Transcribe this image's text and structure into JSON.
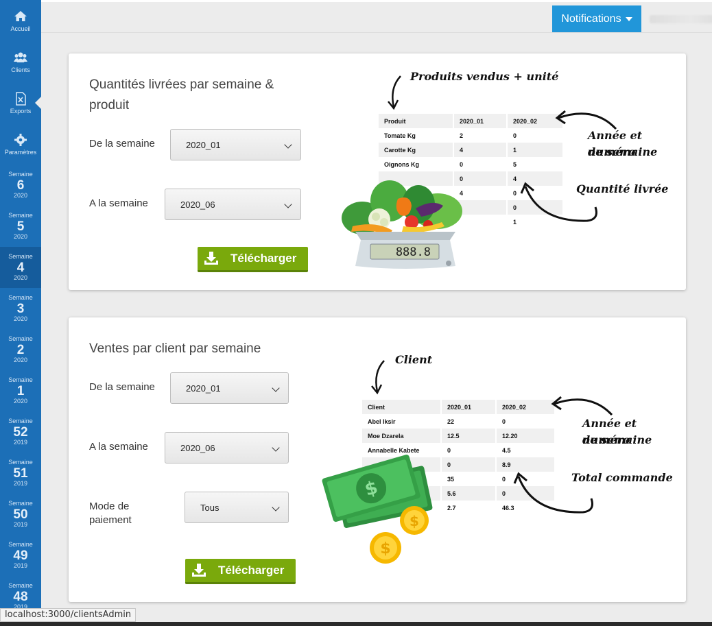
{
  "sidebar": {
    "items": [
      {
        "label": "Accueil",
        "icon": "home-icon"
      },
      {
        "label": "Clients",
        "icon": "users-icon"
      },
      {
        "label": "Exports",
        "icon": "excel-file-icon"
      },
      {
        "label": "Paramètres",
        "icon": "gear-icon"
      }
    ],
    "week_label": "Semaine",
    "weeks": [
      {
        "num": "6",
        "year": "2020"
      },
      {
        "num": "5",
        "year": "2020"
      },
      {
        "num": "4",
        "year": "2020"
      },
      {
        "num": "3",
        "year": "2020"
      },
      {
        "num": "2",
        "year": "2020"
      },
      {
        "num": "1",
        "year": "2020"
      },
      {
        "num": "52",
        "year": "2019"
      },
      {
        "num": "51",
        "year": "2019"
      },
      {
        "num": "50",
        "year": "2019"
      },
      {
        "num": "49",
        "year": "2019"
      },
      {
        "num": "48",
        "year": "2019"
      }
    ]
  },
  "topbar": {
    "notifications_label": "Notifications",
    "accent": "#2196d9"
  },
  "card1": {
    "title": "Quantités livrées par semaine & produit",
    "from_label": "De la semaine",
    "from_value": "2020_01",
    "to_label": "A la semaine",
    "to_value": "2020_06",
    "download_label": "Télécharger",
    "illustration": {
      "header_note": "Produits vendus + unité",
      "year_note_1": "Année et numéro",
      "year_note_2": "de semaine",
      "qty_note": "Quantité livrée",
      "columns": [
        "Produit",
        "2020_01",
        "2020_02"
      ],
      "rows": [
        [
          "Tomate Kg",
          "2",
          "0"
        ],
        [
          "Carotte Kg",
          "4",
          "1"
        ],
        [
          "Oignons Kg",
          "0",
          "5"
        ],
        [
          "",
          "0",
          "4"
        ],
        [
          "",
          "4",
          "0"
        ],
        [
          "",
          "",
          "0"
        ],
        [
          "",
          "",
          "1"
        ]
      ],
      "scale_display": "888.8"
    }
  },
  "card2": {
    "title": "Ventes par client par semaine",
    "from_label": "De la semaine",
    "from_value": "2020_01",
    "to_label": "A la semaine",
    "to_value": "2020_06",
    "payment_label": "Mode de paiement",
    "payment_value": "Tous",
    "download_label": "Télécharger",
    "illustration": {
      "header_note": "Client",
      "year_note_1": "Année et numéro",
      "year_note_2": "de semaine",
      "total_note": "Total commande",
      "columns": [
        "Client",
        "2020_01",
        "2020_02"
      ],
      "rows": [
        [
          "Abel Iksir",
          "22",
          "0"
        ],
        [
          "Moe Dzarela",
          "12.5",
          "12.20"
        ],
        [
          "Annabelle Kabete",
          "0",
          "4.5"
        ],
        [
          "",
          "0",
          "8.9"
        ],
        [
          "",
          "35",
          "0"
        ],
        [
          "",
          "5.6",
          "0"
        ],
        [
          "",
          "2.7",
          "46.3"
        ]
      ]
    }
  },
  "status_url": "localhost:3000/clientsAdmin",
  "colors": {
    "sidebar": "#1c6fb7",
    "download_button": "#7aa90c"
  }
}
